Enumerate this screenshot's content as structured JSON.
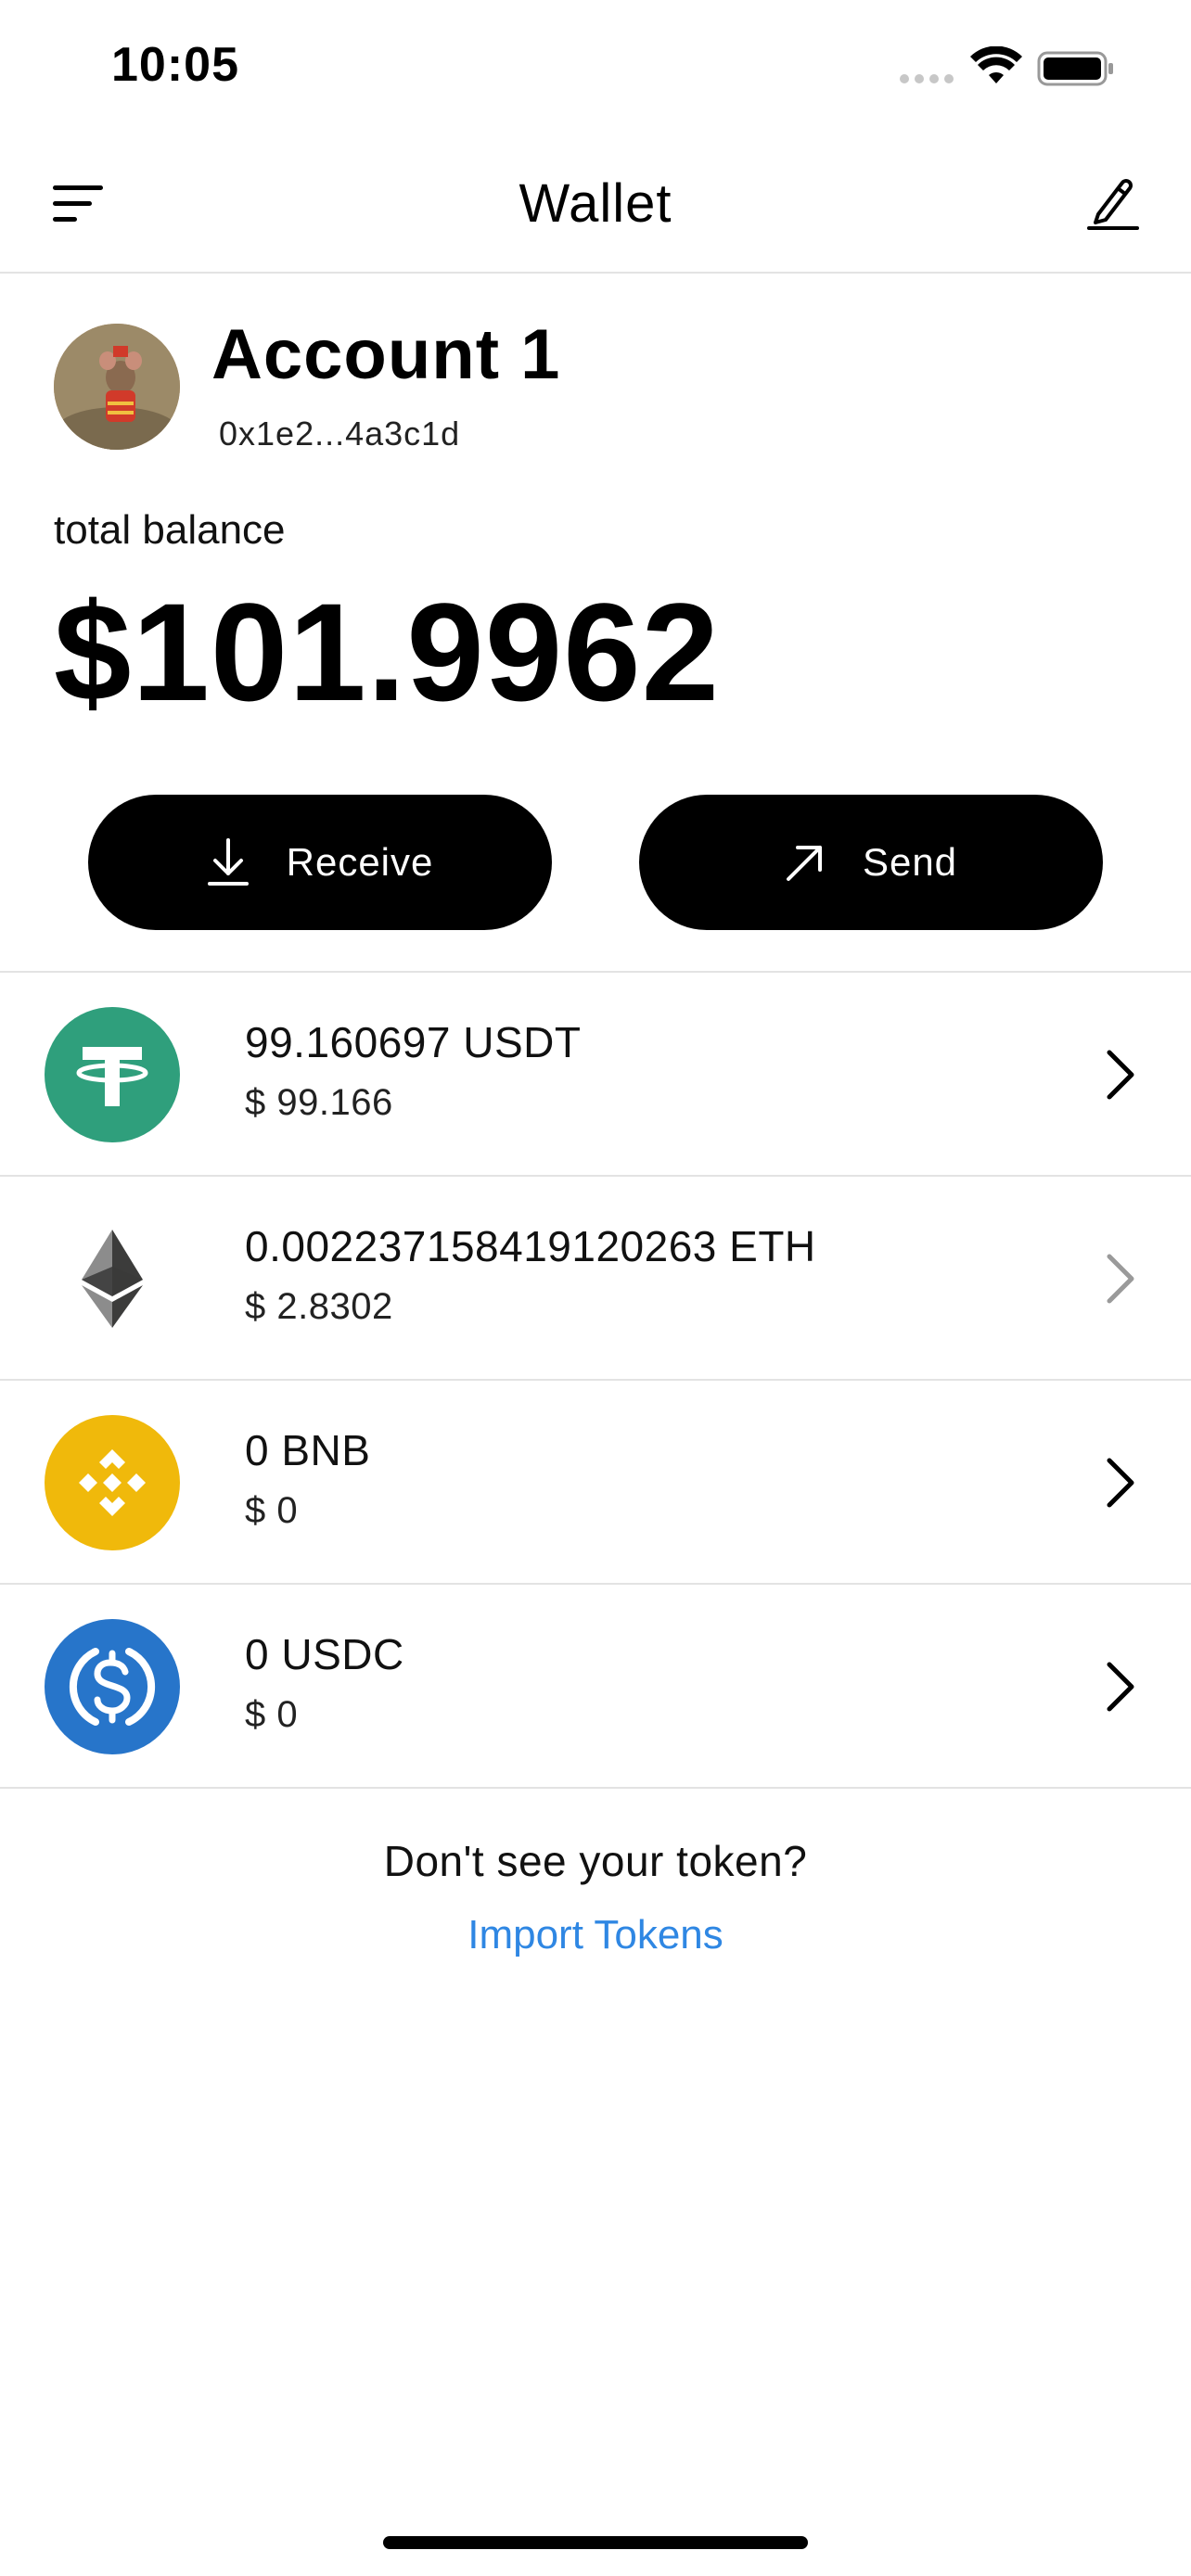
{
  "status_bar": {
    "time": "10:05"
  },
  "header": {
    "title": "Wallet",
    "menu_icon": "menu-icon",
    "edit_icon": "edit-icon"
  },
  "account": {
    "name": "Account 1",
    "address": "0x1e2...4a3c1d",
    "balance_label": "total balance",
    "balance": "$101.9962"
  },
  "actions": {
    "receive_label": "Receive",
    "send_label": "Send"
  },
  "tokens": [
    {
      "amount": "99.160697 USDT",
      "usd": "$ 99.166",
      "icon": "tether-icon",
      "color": "#2f9f7c"
    },
    {
      "amount": "0.002237158419120263 ETH",
      "usd": "$ 2.8302",
      "icon": "ethereum-icon",
      "color": "#343434"
    },
    {
      "amount": "0 BNB",
      "usd": "$ 0",
      "icon": "bnb-icon",
      "color": "#f0b90b"
    },
    {
      "amount": "0 USDC",
      "usd": "$ 0",
      "icon": "usdc-icon",
      "color": "#2775ca"
    }
  ],
  "footer": {
    "missing_text": "Don't see your token?",
    "import_link": "Import Tokens",
    "link_color": "#2f87e3"
  }
}
